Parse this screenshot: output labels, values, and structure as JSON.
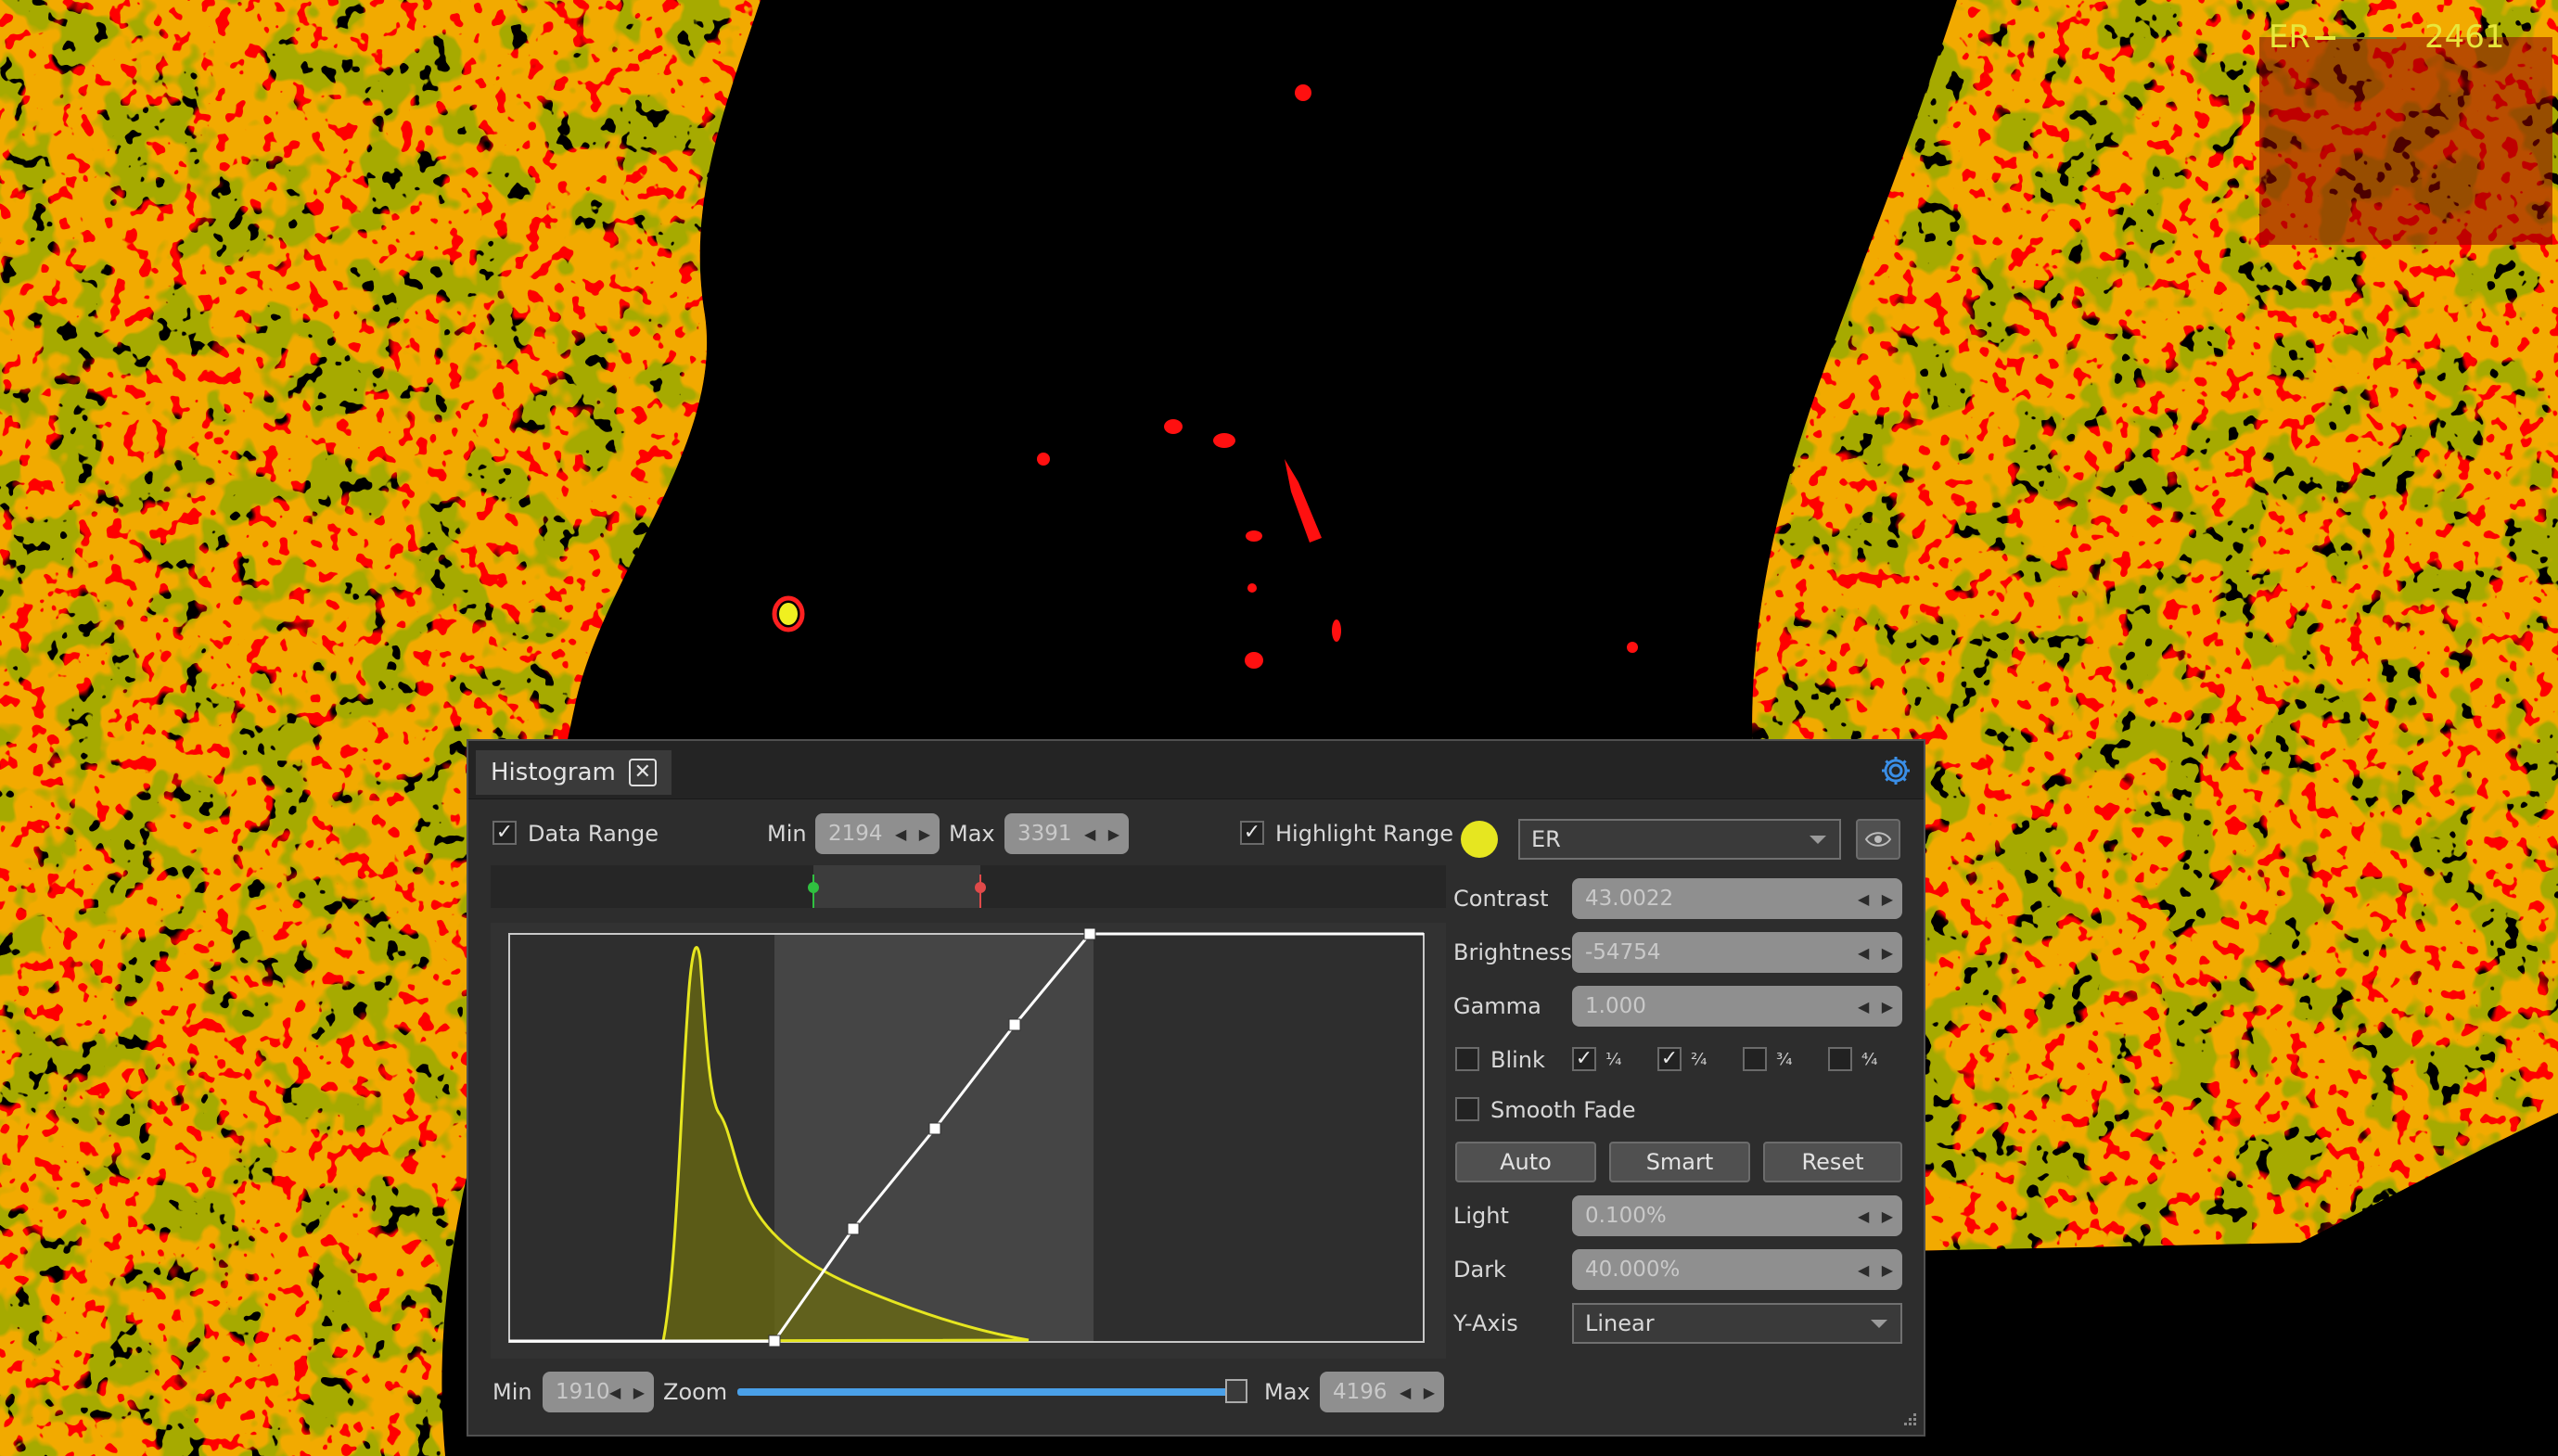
{
  "overlay": {
    "channel": "ER",
    "value": "2461"
  },
  "panel": {
    "tab_title": "Histogram",
    "data_range_label": "Data Range",
    "data_range_checked": true,
    "min_label": "Min",
    "min_value": "2194",
    "max_label": "Max",
    "max_value": "3391",
    "highlight_range_label": "Highlight Range",
    "highlight_range_checked": true,
    "zoom_min_label": "Min",
    "zoom_min_value": "1910",
    "zoom_label": "Zoom",
    "zoom_max_label": "Max",
    "zoom_max_value": "4196",
    "zoom_level": 1.0
  },
  "channel": {
    "color": "#e6e620",
    "name": "ER"
  },
  "props": {
    "contrast_label": "Contrast",
    "contrast": "43.0022",
    "brightness_label": "Brightness",
    "brightness": "-54754",
    "gamma_label": "Gamma",
    "gamma": "1.000",
    "blink_label": "Blink",
    "quarters": [
      {
        "label": "¹⁄₄",
        "checked": true
      },
      {
        "label": "²⁄₄",
        "checked": true
      },
      {
        "label": "³⁄₄",
        "checked": false
      },
      {
        "label": "⁴⁄₄",
        "checked": false
      }
    ],
    "smooth_fade_label": "Smooth Fade",
    "auto": "Auto",
    "smart": "Smart",
    "reset": "Reset",
    "light_label": "Light",
    "light": "0.100%",
    "dark_label": "Dark",
    "dark": "40.000%",
    "yaxis_label": "Y-Axis",
    "yaxis": "Linear"
  },
  "colors": {
    "accent": "#4aa0e8",
    "histogram": "#e6e620",
    "image_red": "#ff0000"
  }
}
